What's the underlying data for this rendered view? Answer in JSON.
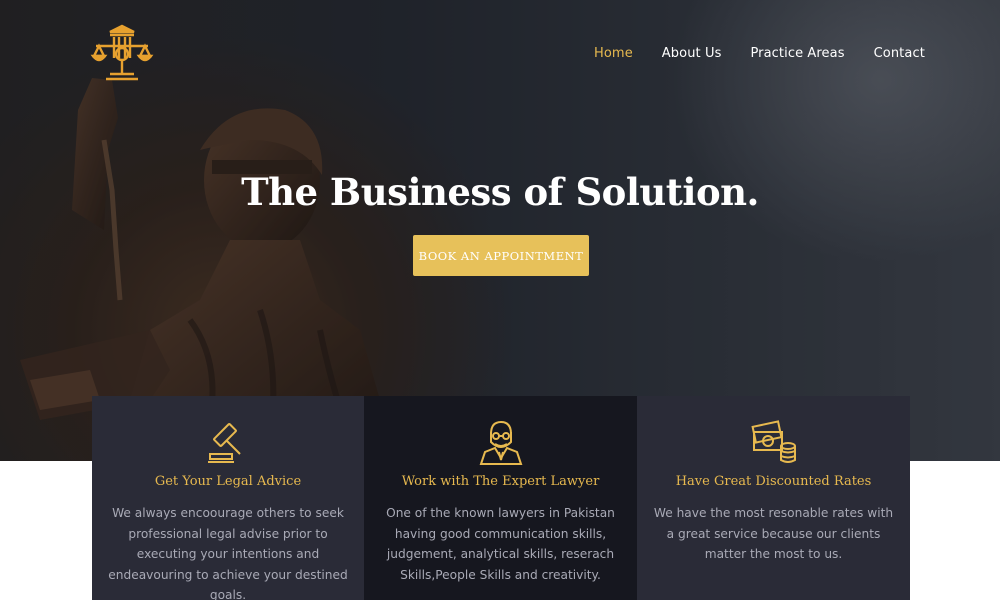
{
  "brand": {
    "logo": "law-scales-pillar-logo",
    "accent_color": "#e7b94f"
  },
  "nav": {
    "items": [
      {
        "label": "Home",
        "active": true
      },
      {
        "label": "About Us",
        "active": false
      },
      {
        "label": "Practice Areas",
        "active": false
      },
      {
        "label": "Contact",
        "active": false
      }
    ]
  },
  "hero": {
    "title": "The Business of Solution.",
    "cta_label": "BOOK AN APPOINTMENT",
    "cta_color": "#e7c15a"
  },
  "features": [
    {
      "icon": "gavel-icon",
      "title": "Get Your Legal Advice",
      "text": "We always encoourage others to seek professional legal advise prior to executing your intentions and endeavouring to achieve your destined goals."
    },
    {
      "icon": "lawyer-icon",
      "title": "Work with The Expert Lawyer",
      "text": "One of the known lawyers in Pakistan having good communication skills, judgement, analytical skills, reserach Skills,People Skills and creativity."
    },
    {
      "icon": "money-coins-icon",
      "title": "Have Great Discounted Rates",
      "text": "We have the most resonable rates with a great service because our clients matter the most to us."
    }
  ]
}
